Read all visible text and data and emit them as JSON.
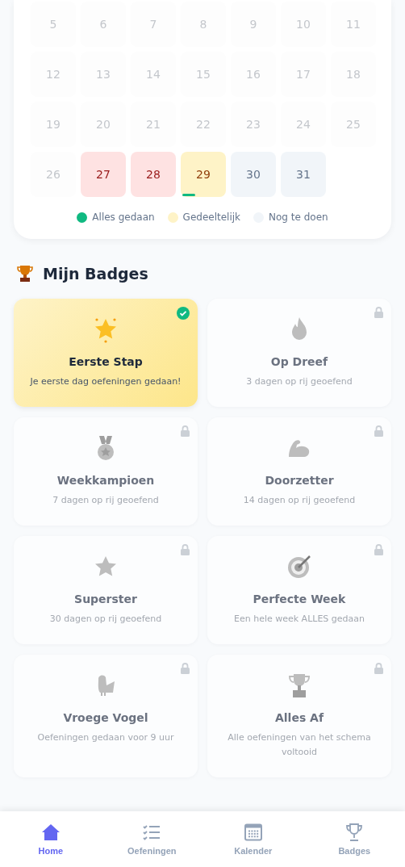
{
  "calendar": {
    "weeks": [
      [
        {
          "day": "5",
          "kind": "past"
        },
        {
          "day": "6",
          "kind": "past"
        },
        {
          "day": "7",
          "kind": "past"
        },
        {
          "day": "8",
          "kind": "past"
        },
        {
          "day": "9",
          "kind": "past"
        },
        {
          "day": "10",
          "kind": "past"
        },
        {
          "day": "11",
          "kind": "past"
        }
      ],
      [
        {
          "day": "12",
          "kind": "past"
        },
        {
          "day": "13",
          "kind": "past"
        },
        {
          "day": "14",
          "kind": "past"
        },
        {
          "day": "15",
          "kind": "past"
        },
        {
          "day": "16",
          "kind": "past"
        },
        {
          "day": "17",
          "kind": "past"
        },
        {
          "day": "18",
          "kind": "past"
        }
      ],
      [
        {
          "day": "19",
          "kind": "past"
        },
        {
          "day": "20",
          "kind": "past"
        },
        {
          "day": "21",
          "kind": "past"
        },
        {
          "day": "22",
          "kind": "past"
        },
        {
          "day": "23",
          "kind": "past"
        },
        {
          "day": "24",
          "kind": "past"
        },
        {
          "day": "25",
          "kind": "past"
        }
      ],
      [
        {
          "day": "26",
          "kind": "past"
        },
        {
          "day": "27",
          "kind": "missed"
        },
        {
          "day": "28",
          "kind": "missed"
        },
        {
          "day": "29",
          "kind": "partial",
          "level": 0.3
        },
        {
          "day": "30",
          "kind": "todo"
        },
        {
          "day": "31",
          "kind": "todo"
        }
      ]
    ],
    "legend": [
      {
        "label": "Alles gedaan",
        "color": "#10b981"
      },
      {
        "label": "Gedeeltelijk",
        "color": "#fef3c7"
      },
      {
        "label": "Nog te doen",
        "color": "#f1f5f9"
      }
    ]
  },
  "badges_section": {
    "title": "Mijn Badges"
  },
  "badges": [
    {
      "kind": "star",
      "title": "Eerste Stap",
      "description": "Je eerste dag oefeningen gedaan!",
      "earned": true
    },
    {
      "kind": "flame",
      "title": "Op Dreef",
      "description": "3 dagen op rij geoefend",
      "earned": false
    },
    {
      "kind": "medal",
      "title": "Weekkampioen",
      "description": "7 dagen op rij geoefend",
      "earned": false
    },
    {
      "kind": "muscle",
      "title": "Doorzetter",
      "description": "14 dagen op rij geoefend",
      "earned": false
    },
    {
      "kind": "star",
      "title": "Superster",
      "description": "30 dagen op rij geoefend",
      "earned": false
    },
    {
      "kind": "target",
      "title": "Perfecte Week",
      "description": "Een hele week ALLES gedaan",
      "earned": false
    },
    {
      "kind": "bird",
      "title": "Vroege Vogel",
      "description": "Oefeningen gedaan voor 9 uur",
      "earned": false
    },
    {
      "kind": "trophy",
      "title": "Alles Af",
      "description": "Alle oefeningen van het schema voltooid",
      "earned": false
    }
  ],
  "nav": [
    {
      "kind": "home",
      "label": "Home",
      "selected": true
    },
    {
      "kind": "list",
      "label": "Oefeningen",
      "selected": false
    },
    {
      "kind": "calendar",
      "label": "Kalender",
      "selected": false
    },
    {
      "kind": "trophy",
      "label": "Badges",
      "selected": false
    }
  ]
}
